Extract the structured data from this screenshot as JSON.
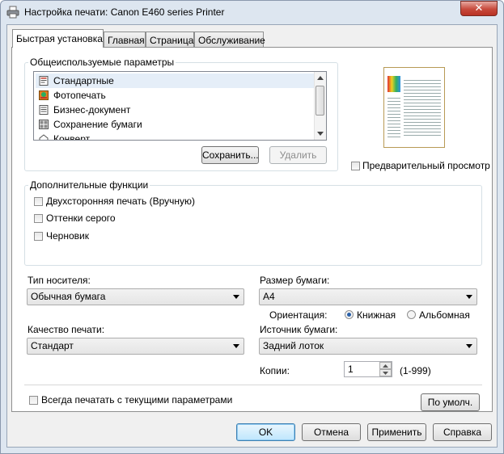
{
  "window": {
    "title": "Настройка печати: Canon E460 series Printer",
    "close_label": "✕"
  },
  "tabs": [
    {
      "label": "Быстрая установка",
      "active": true
    },
    {
      "label": "Главная"
    },
    {
      "label": "Страница"
    },
    {
      "label": "Обслуживание"
    }
  ],
  "presets": {
    "group_label": "Общеиспользуемые параметры",
    "items": [
      {
        "label": "Стандартные",
        "icon": "standard-icon",
        "selected": true
      },
      {
        "label": "Фотопечать",
        "icon": "photo-icon"
      },
      {
        "label": "Бизнес-документ",
        "icon": "document-icon"
      },
      {
        "label": "Сохранение бумаги",
        "icon": "paper-saving-icon"
      },
      {
        "label": "Конверт",
        "icon": "envelope-icon"
      }
    ],
    "save_label": "Сохранить...",
    "delete_label": "Удалить"
  },
  "preview": {
    "label": "Предварительный просмотр"
  },
  "extra": {
    "group_label": "Дополнительные функции",
    "options": [
      {
        "label": "Двухсторонняя печать (Вручную)"
      },
      {
        "label": "Оттенки серого"
      },
      {
        "label": "Черновик"
      }
    ]
  },
  "media": {
    "label": "Тип носителя:",
    "value": "Обычная бумага"
  },
  "paper_size": {
    "label": "Размер бумаги:",
    "value": "A4"
  },
  "orientation": {
    "label": "Ориентация:",
    "portrait": "Книжная",
    "landscape": "Альбомная",
    "selected": "Книжная"
  },
  "quality": {
    "label": "Качество печати:",
    "value": "Стандарт"
  },
  "source": {
    "label": "Источник бумаги:",
    "value": "Задний лоток"
  },
  "copies": {
    "label": "Копии:",
    "value": "1",
    "range": "(1-999)"
  },
  "always_print": {
    "label": "Всегда печатать с текущими параметрами"
  },
  "defaults_label": "По умолч.",
  "footer": {
    "ok": "OK",
    "cancel": "Отмена",
    "apply": "Применить",
    "help": "Справка"
  },
  "colors": {
    "accent": "#3c7fb1",
    "close": "#c74a3c"
  }
}
